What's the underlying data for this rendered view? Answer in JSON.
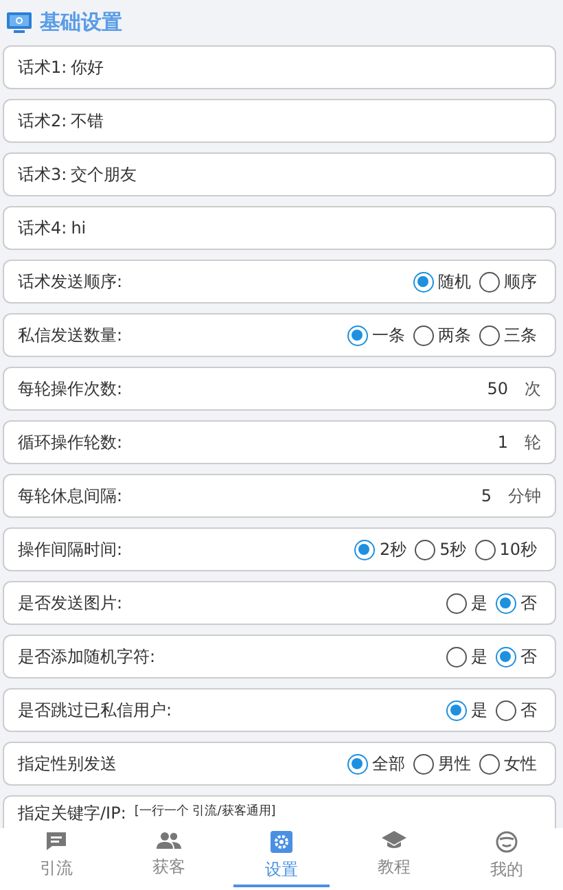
{
  "header": {
    "title": "基础设置"
  },
  "rows": [
    {
      "kind": "text",
      "label": "话术1:",
      "value": "你好"
    },
    {
      "kind": "text",
      "label": "话术2:",
      "value": "不错"
    },
    {
      "kind": "text",
      "label": "话术3:",
      "value": "交个朋友"
    },
    {
      "kind": "text",
      "label": "话术4:",
      "value": "hi"
    },
    {
      "kind": "radio",
      "label": "话术发送顺序:",
      "options": [
        {
          "label": "随机",
          "selected": true
        },
        {
          "label": "顺序",
          "selected": false
        }
      ]
    },
    {
      "kind": "radio",
      "label": "私信发送数量:",
      "options": [
        {
          "label": "一条",
          "selected": true
        },
        {
          "label": "两条",
          "selected": false
        },
        {
          "label": "三条",
          "selected": false
        }
      ]
    },
    {
      "kind": "number",
      "label": "每轮操作次数:",
      "value": "50",
      "unit": "次"
    },
    {
      "kind": "number",
      "label": "循环操作轮数:",
      "value": "1",
      "unit": "轮"
    },
    {
      "kind": "number",
      "label": "每轮休息间隔:",
      "value": "5",
      "unit": "分钟"
    },
    {
      "kind": "radio",
      "label": "操作间隔时间:",
      "options": [
        {
          "label": "2秒",
          "selected": true
        },
        {
          "label": "5秒",
          "selected": false
        },
        {
          "label": "10秒",
          "selected": false
        }
      ]
    },
    {
      "kind": "radio",
      "label": "是否发送图片:",
      "options": [
        {
          "label": "是",
          "selected": false
        },
        {
          "label": "否",
          "selected": true
        }
      ]
    },
    {
      "kind": "radio",
      "label": "是否添加随机字符:",
      "options": [
        {
          "label": "是",
          "selected": false
        },
        {
          "label": "否",
          "selected": true
        }
      ]
    },
    {
      "kind": "radio",
      "label": "是否跳过已私信用户:",
      "options": [
        {
          "label": "是",
          "selected": true
        },
        {
          "label": "否",
          "selected": false
        }
      ]
    },
    {
      "kind": "radio",
      "label": "指定性别发送",
      "options": [
        {
          "label": "全部",
          "selected": true
        },
        {
          "label": "男性",
          "selected": false
        },
        {
          "label": "女性",
          "selected": false
        }
      ]
    },
    {
      "kind": "keyword",
      "label": "指定关键字/IP:",
      "hint": "[一行一个 引流/获客通用]"
    }
  ],
  "tabs": [
    {
      "label": "引流",
      "kind": "chat",
      "selected": false
    },
    {
      "label": "获客",
      "kind": "people",
      "selected": false
    },
    {
      "label": "设置",
      "kind": "gear",
      "selected": true
    },
    {
      "label": "教程",
      "kind": "cap",
      "selected": false
    },
    {
      "label": "我的",
      "kind": "face",
      "selected": false
    }
  ]
}
